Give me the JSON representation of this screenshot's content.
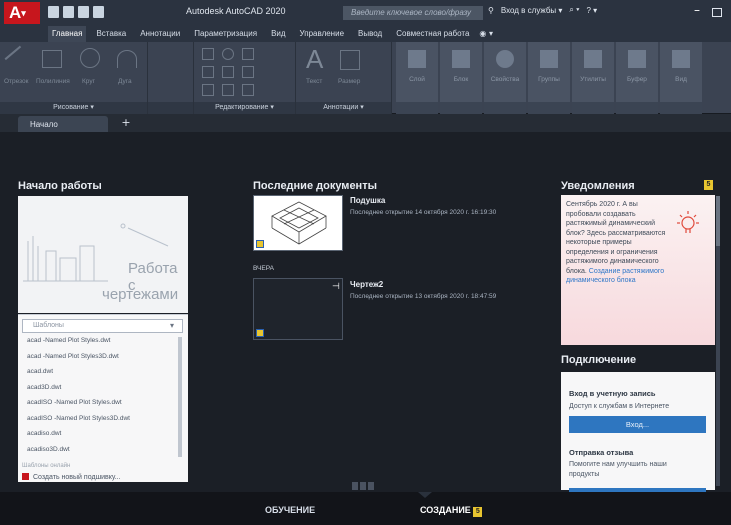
{
  "titlebar": {
    "logo": "A",
    "logo_suffix": "▾",
    "app_title": "Autodesk AutoCAD 2020",
    "search_placeholder": "Введите ключевое слово/фразу",
    "signin": "Вход в службы ▾",
    "cart": "⌕ ▾",
    "help": "? ▾"
  },
  "tabs": [
    "Главная",
    "Вставка",
    "Аннотации",
    "Параметризация",
    "Вид",
    "Управление",
    "Вывод",
    "Совместная работа"
  ],
  "tab_extra": "◉ ▾",
  "ribbon": {
    "draw": {
      "label": "Рисование ▾",
      "buttons": [
        "Отрезок",
        "Полилиния",
        "Круг",
        "Дуга"
      ]
    },
    "modify": {
      "label": "Редактирование ▾"
    },
    "annotation": {
      "label": "Аннотации ▾",
      "buttons": [
        "Текст",
        "Размер"
      ]
    },
    "disabled_buttons": [
      "Слой",
      "Блок",
      "Свойства",
      "Группы",
      "Утилиты",
      "Буфер",
      "Вид"
    ]
  },
  "doc_tab": "Начало",
  "doc_tab_add": "+",
  "start": {
    "title": "Начало работы",
    "card_line1": "Работа с",
    "card_line2": "чертежами",
    "template_placeholder": "Шаблоны",
    "templates": [
      "acad -Named Plot Styles.dwt",
      "acad -Named Plot Styles3D.dwt",
      "acad.dwt",
      "acad3D.dwt",
      "acadISO -Named Plot Styles.dwt",
      "acadISO -Named Plot Styles3D.dwt",
      "acadiso.dwt",
      "acadiso3D.dwt"
    ],
    "more_templates": "Шаблоны онлайн",
    "new_sheet": "Создать новый подшивку..."
  },
  "recent": {
    "title": "Последние документы",
    "items": [
      {
        "name": "Подушка",
        "meta": "Последнее открытие 14 октября 2020 г. 16:19:30"
      },
      {
        "name": "Чертеж2",
        "meta": "Последнее открытие 13 октября 2020 г. 18:47:59"
      }
    ],
    "yesterday": "ВЧЕРА",
    "pin": "⊣"
  },
  "notifications": {
    "title": "Уведомления",
    "count": "5",
    "text": "Сентябрь 2020 г. А вы пробовали создавать растяжимый динамический блок? Здесь рассматриваются некоторые примеры определения и ограничения растяжимого динамического блока.",
    "link": "Создание растяжимого динамического блока"
  },
  "connect": {
    "title": "Подключение",
    "signin_heading": "Вход в учетную запись",
    "signin_text": "Доступ к службам в Интернете",
    "signin_button": "Вход...",
    "feedback_heading": "Отправка отзыва",
    "feedback_text": "Помогите нам улучшить наши продукты"
  },
  "bottom": {
    "learn": "ОБУЧЕНИЕ",
    "create": "СОЗДАНИЕ",
    "create_badge": "5"
  },
  "colors": {
    "logo_red": "#c7161d",
    "accent_blue": "#2e76c0",
    "badge_yellow": "#e8c530"
  }
}
